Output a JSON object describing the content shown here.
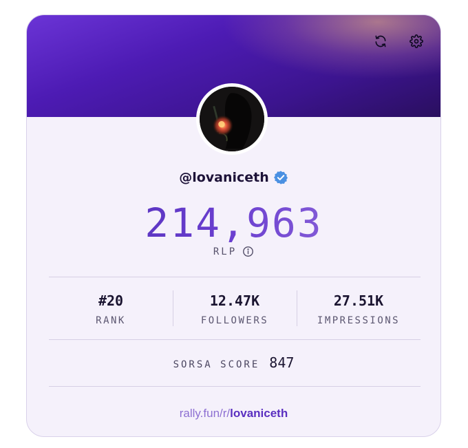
{
  "profile": {
    "handle": "@lovaniceth",
    "verified": true,
    "avatar_icon": "profile-avatar"
  },
  "header": {
    "refresh_icon": "refresh-icon",
    "settings_icon": "gear-icon"
  },
  "score": {
    "value": "214,963",
    "label": "RLP",
    "info_icon": "info-icon"
  },
  "stats": [
    {
      "value": "#20",
      "label": "RANK"
    },
    {
      "value": "12.47K",
      "label": "FOLLOWERS"
    },
    {
      "value": "27.51K",
      "label": "IMPRESSIONS"
    }
  ],
  "sorsa": {
    "label": "SORSA SCORE",
    "value": "847"
  },
  "link": {
    "prefix": "rally.fun/r/",
    "user": "lovaniceth"
  },
  "colors": {
    "accent": "#5a2fc0",
    "banner_start": "#6b34d6",
    "banner_end": "#2a0f5f",
    "verified_badge": "#4a90e2",
    "card_background": "#f5f1fb"
  }
}
